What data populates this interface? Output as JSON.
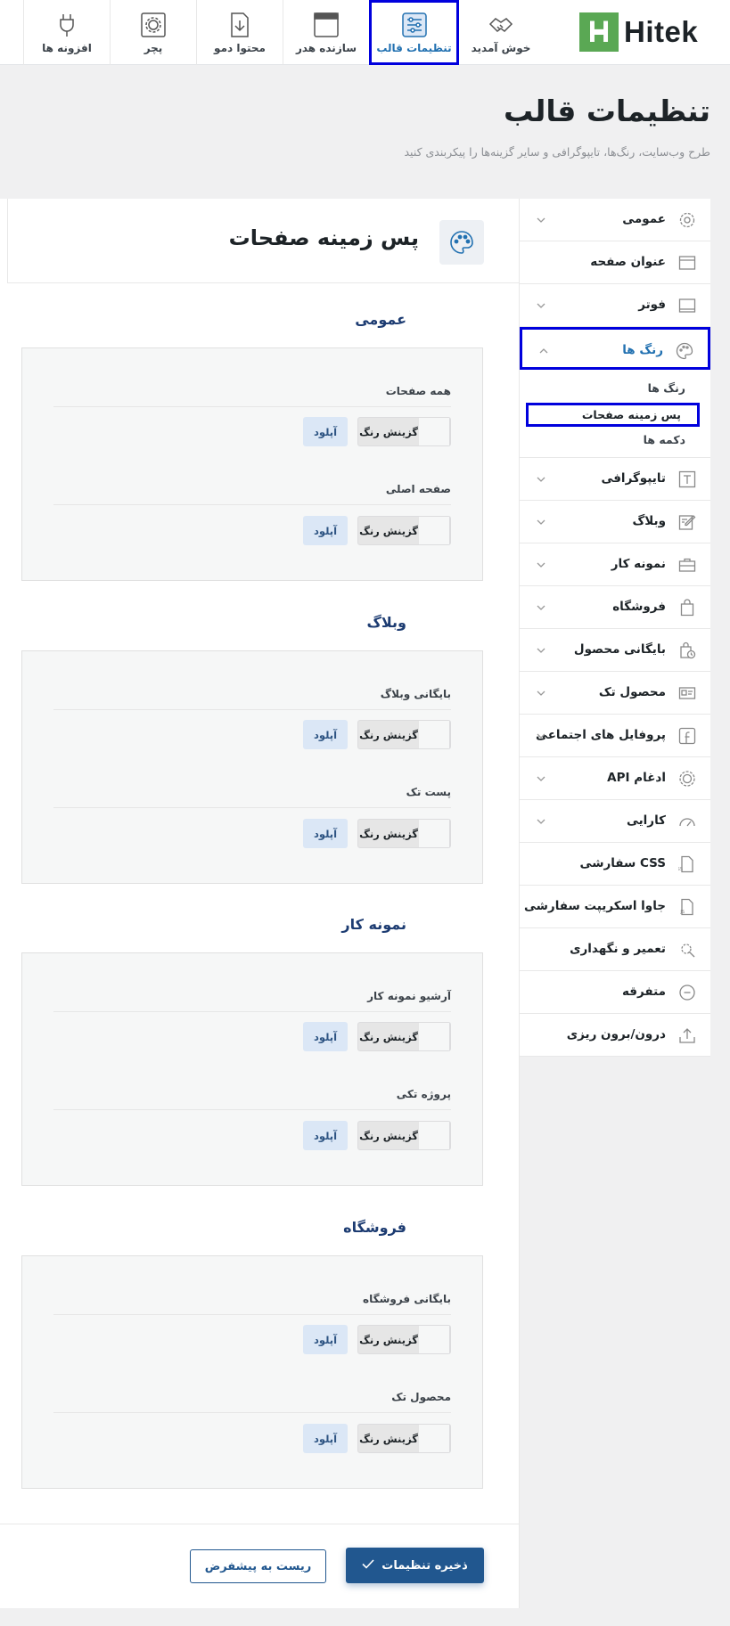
{
  "brand": {
    "logo_text": "Hitek",
    "logo_letter": "H",
    "accent": "#2271b1",
    "highlight": "#0000dd",
    "green": "#5aa854"
  },
  "topbar": {
    "tabs": [
      {
        "label": "خوش آمدید",
        "icon": "handshake-icon"
      },
      {
        "label": "تنظیمات قالب",
        "icon": "settings-sliders-icon",
        "active": true
      },
      {
        "label": "سازنده هدر",
        "icon": "header-window-icon"
      },
      {
        "label": "محتوا دمو",
        "icon": "document-download-icon"
      },
      {
        "label": "پچر",
        "icon": "gear-patch-icon"
      },
      {
        "label": "افزونه ها",
        "icon": "plug-icon"
      }
    ]
  },
  "header": {
    "title": "تنظیمات قالب",
    "subtitle": "طرح وب‌سایت، رنگ‌ها، تایپوگرافی و سایر گزینه‌ها را پیکربندی کنید"
  },
  "sidebar": {
    "items": [
      {
        "label": "عمومی",
        "icon": "gear-icon",
        "chevron": "down"
      },
      {
        "label": "عنوان صفحه",
        "icon": "title-bar-icon"
      },
      {
        "label": "فوتر",
        "icon": "footer-icon",
        "chevron": "down"
      },
      {
        "label": "رنگ ها",
        "icon": "palette-icon",
        "chevron": "up",
        "open": true
      },
      {
        "label": "تایپوگرافی",
        "icon": "typography-icon",
        "chevron": "down"
      },
      {
        "label": "وبلاگ",
        "icon": "edit-icon",
        "chevron": "down"
      },
      {
        "label": "نمونه کار",
        "icon": "briefcase-icon",
        "chevron": "down"
      },
      {
        "label": "فروشگاه",
        "icon": "shopping-bag-icon",
        "chevron": "down"
      },
      {
        "label": "بایگانی محصول",
        "icon": "bag-clock-icon",
        "chevron": "down"
      },
      {
        "label": "محصول تک",
        "icon": "product-card-icon",
        "chevron": "down"
      },
      {
        "label": "پروفایل های اجتماعی",
        "icon": "facebook-icon",
        "chevron": "down"
      },
      {
        "label": "ادغام API",
        "icon": "api-icon",
        "chevron": "down"
      },
      {
        "label": "کارایی",
        "icon": "speedometer-icon",
        "chevron": "down"
      },
      {
        "label": "CSS سفارشی",
        "icon": "css-file-icon"
      },
      {
        "label": "جاوا اسکریپت سفارشی",
        "icon": "js-file-icon"
      },
      {
        "label": "تعمیر و نگهداری",
        "icon": "wrench-gear-icon"
      },
      {
        "label": "متفرقه",
        "icon": "more-circle-icon"
      },
      {
        "label": "درون/برون ریزی",
        "icon": "upload-icon"
      }
    ],
    "sub_items": [
      "رنگ ها",
      "پس زمینه صفحات",
      "دکمه ها"
    ],
    "active_sub": 1
  },
  "panel": {
    "title": "پس زمینه صفحات",
    "icon": "palette-icon",
    "color_picker_label": "گزینش رنگ",
    "upload_label": "آپلود",
    "sections": [
      {
        "title": "عمومی",
        "fields": [
          "همه صفحات",
          "صفحه اصلی"
        ]
      },
      {
        "title": "وبلاگ",
        "fields": [
          "بایگانی وبلاگ",
          "پست تک"
        ]
      },
      {
        "title": "نمونه کار",
        "fields": [
          "آرشیو نمونه کار",
          "پروژه تکی"
        ]
      },
      {
        "title": "فروشگاه",
        "fields": [
          "بایگانی فروشگاه",
          "محصول تک"
        ]
      }
    ],
    "save_label": "ذخیره تنظیمات",
    "reset_label": "ریست به پیشفرض"
  }
}
